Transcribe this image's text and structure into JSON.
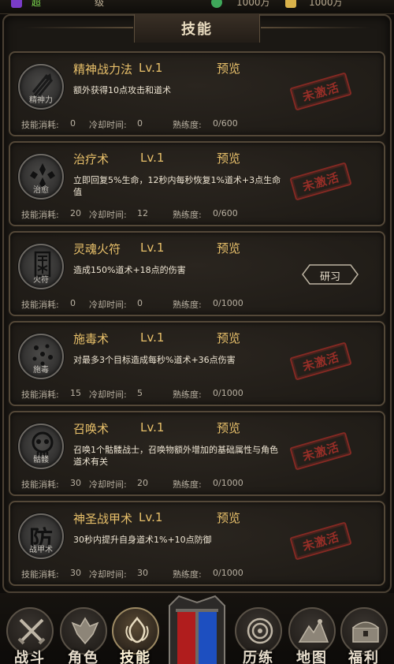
{
  "header": {
    "level_text": "级",
    "green_text": "超",
    "gold_a": "1000万",
    "gold_b": "1000万"
  },
  "panel": {
    "title": "技能"
  },
  "labels": {
    "preview": "预览",
    "cost": "技能消耗:",
    "cooldown": "冷却时间:",
    "proficiency": "熟练度:",
    "inactive": "未激活",
    "research": "研习"
  },
  "skills": [
    {
      "name": "精神战力法",
      "level": "Lv.1",
      "desc": "额外获得10点攻击和道术",
      "cost": "0",
      "cooldown": "0",
      "proficiency": "0/600",
      "state": "inactive",
      "icon_name": "spirit-power-icon",
      "icon_caption": "精神力"
    },
    {
      "name": "治疗术",
      "level": "Lv.1",
      "desc": "立即回复5%生命，12秒内每秒恢复1%道术+3点生命值",
      "cost": "20",
      "cooldown": "12",
      "proficiency": "0/600",
      "state": "inactive",
      "icon_name": "heal-icon",
      "icon_caption": "治愈"
    },
    {
      "name": "灵魂火符",
      "level": "Lv.1",
      "desc": "造成150%道术+18点的伤害",
      "cost": "0",
      "cooldown": "0",
      "proficiency": "0/1000",
      "state": "research",
      "icon_name": "soul-talisman-icon",
      "icon_caption": "火符"
    },
    {
      "name": "施毒术",
      "level": "Lv.1",
      "desc": "对最多3个目标造成每秒%道术+36点伤害",
      "cost": "15",
      "cooldown": "5",
      "proficiency": "0/1000",
      "state": "inactive",
      "icon_name": "poison-icon",
      "icon_caption": "施毒"
    },
    {
      "name": "召唤术",
      "level": "Lv.1",
      "desc": "召唤1个骷髅战士，召唤物额外增加的基础属性与角色道术有关",
      "cost": "30",
      "cooldown": "20",
      "proficiency": "0/1000",
      "state": "inactive",
      "icon_name": "skull-summon-icon",
      "icon_caption": "骷髅"
    },
    {
      "name": "神圣战甲术",
      "level": "Lv.1",
      "desc": "30秒内提升自身道术1%+10点防御",
      "cost": "30",
      "cooldown": "30",
      "proficiency": "0/1000",
      "state": "inactive",
      "icon_name": "holy-armor-icon",
      "icon_caption": "战甲术",
      "icon_glyph": "防"
    }
  ],
  "nav": [
    {
      "label": "战斗",
      "icon": "crossed-swords-icon",
      "active": false
    },
    {
      "label": "角色",
      "icon": "helmet-icon",
      "active": false
    },
    {
      "label": "技能",
      "icon": "flame-skill-icon",
      "active": true
    },
    {
      "label": "历练",
      "icon": "spiral-trial-icon",
      "active": false
    },
    {
      "label": "地图",
      "icon": "mountain-map-icon",
      "active": false
    },
    {
      "label": "福利",
      "icon": "treasure-chest-icon",
      "active": false
    }
  ],
  "colors": {
    "accent_gold": "#e8c06a",
    "stamp_red": "#9e2f28",
    "panel_bg": "#1b1814"
  }
}
